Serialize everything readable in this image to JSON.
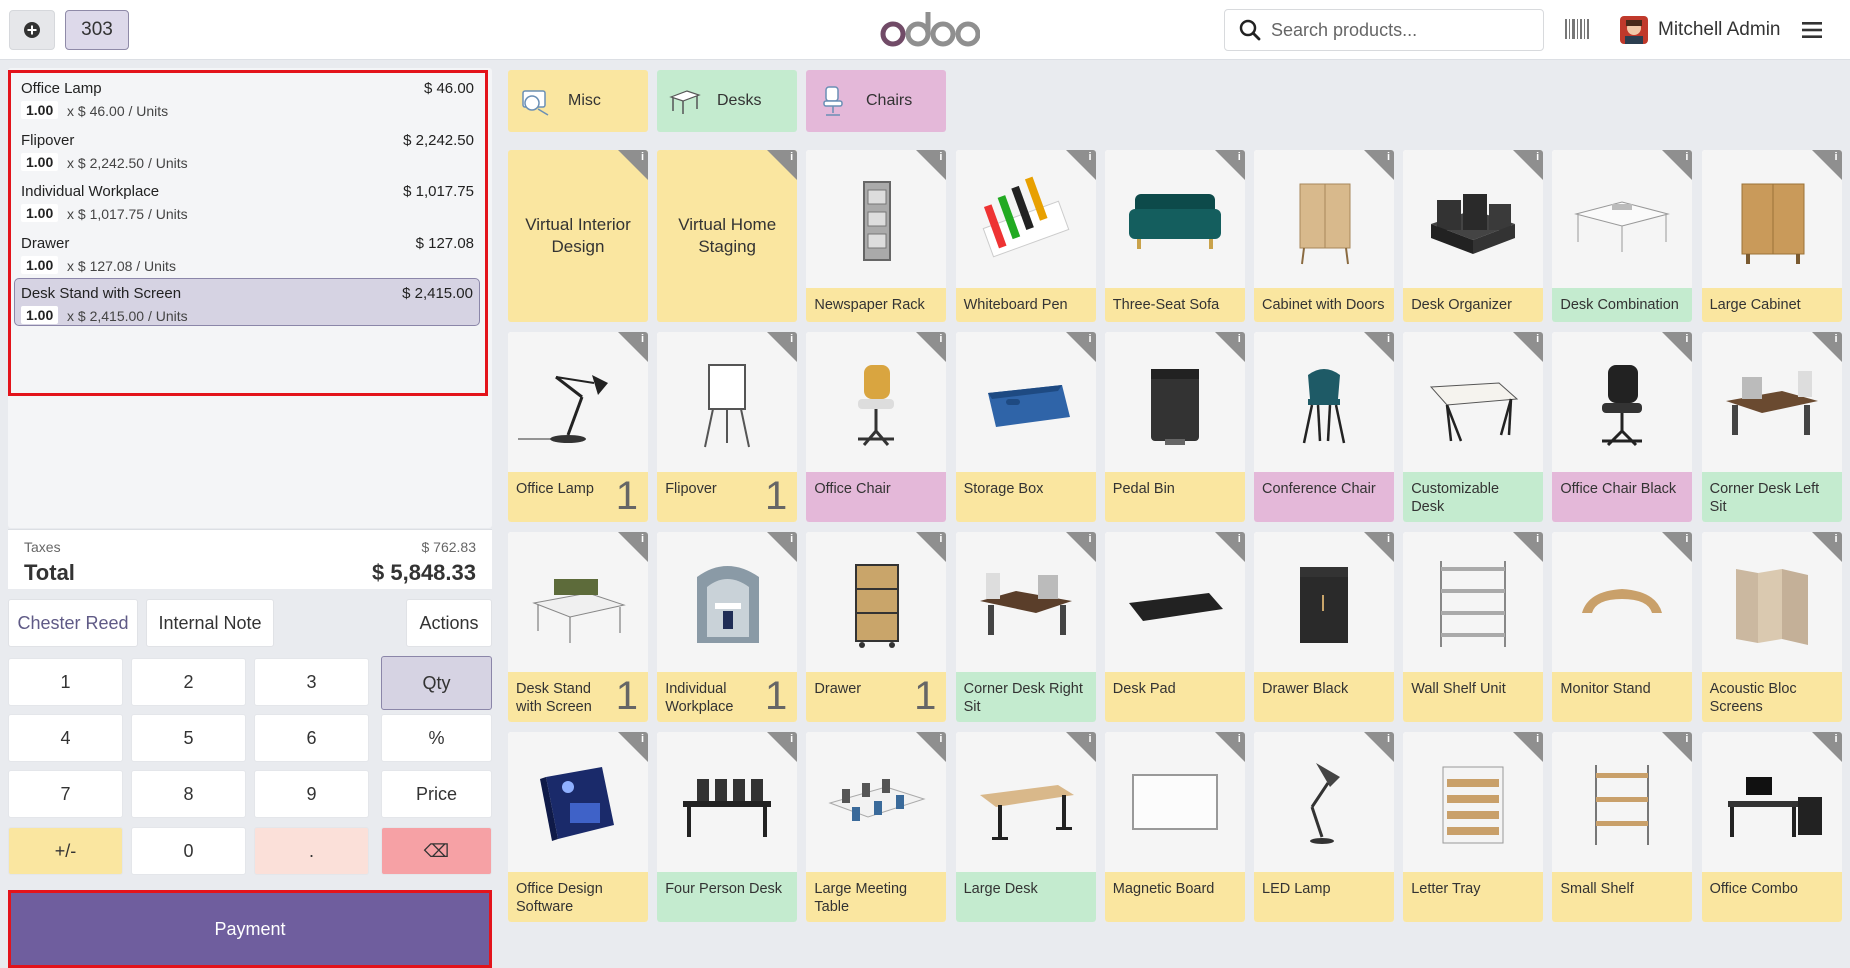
{
  "header": {
    "order_number": "303",
    "search_placeholder": "Search products...",
    "user_name": "Mitchell Admin"
  },
  "order_lines": [
    {
      "name": "Office Lamp",
      "price": "$ 46.00",
      "qty": "1.00",
      "unit": "x $ 46.00 / Units",
      "selected": false
    },
    {
      "name": "Flipover",
      "price": "$ 2,242.50",
      "qty": "1.00",
      "unit": "x $ 2,242.50 / Units",
      "selected": false
    },
    {
      "name": "Individual Workplace",
      "price": "$ 1,017.75",
      "qty": "1.00",
      "unit": "x $ 1,017.75 / Units",
      "selected": false
    },
    {
      "name": "Drawer",
      "price": "$ 127.08",
      "qty": "1.00",
      "unit": "x $ 127.08 / Units",
      "selected": false
    },
    {
      "name": "Desk Stand with Screen",
      "price": "$ 2,415.00",
      "qty": "1.00",
      "unit": "x $ 2,415.00 / Units",
      "selected": true
    }
  ],
  "totals": {
    "taxes_label": "Taxes",
    "taxes_value": "$ 762.83",
    "total_label": "Total",
    "total_value": "$ 5,848.33"
  },
  "controls": {
    "customer": "Chester Reed",
    "note": "Internal Note",
    "actions": "Actions"
  },
  "numpad": {
    "k1": "1",
    "k2": "2",
    "k3": "3",
    "qty": "Qty",
    "k4": "4",
    "k5": "5",
    "k6": "6",
    "percent": "%",
    "k7": "7",
    "k8": "8",
    "k9": "9",
    "price": "Price",
    "plusminus": "+/-",
    "k0": "0",
    "dot": ".",
    "backspace": "⌫"
  },
  "payment_label": "Payment",
  "categories": [
    {
      "label": "Misc",
      "color": "#fae6a0"
    },
    {
      "label": "Desks",
      "color": "#c4ebcf"
    },
    {
      "label": "Chairs",
      "color": "#e4b8d9"
    }
  ],
  "colors": {
    "yellow": "#fae6a0",
    "green": "#c4ebcf",
    "pink": "#e4b8d9",
    "payment": "#6f5e9e"
  },
  "products": [
    {
      "name": "Virtual Interior Design",
      "qty": ""
    },
    {
      "name": "Virtual Home Staging",
      "qty": ""
    },
    {
      "name": "Newspaper Rack",
      "qty": ""
    },
    {
      "name": "Whiteboard Pen",
      "qty": ""
    },
    {
      "name": "Three-Seat Sofa",
      "qty": ""
    },
    {
      "name": "Cabinet with Doors",
      "qty": ""
    },
    {
      "name": "Desk Organizer",
      "qty": ""
    },
    {
      "name": "Desk Combination",
      "qty": ""
    },
    {
      "name": "Large Cabinet",
      "qty": ""
    },
    {
      "name": "Office Lamp",
      "qty": "1"
    },
    {
      "name": "Flipover",
      "qty": "1"
    },
    {
      "name": "Office Chair",
      "qty": ""
    },
    {
      "name": "Storage Box",
      "qty": ""
    },
    {
      "name": "Pedal Bin",
      "qty": ""
    },
    {
      "name": "Conference Chair",
      "qty": ""
    },
    {
      "name": "Customizable Desk",
      "qty": ""
    },
    {
      "name": "Office Chair Black",
      "qty": ""
    },
    {
      "name": "Corner Desk Left Sit",
      "qty": ""
    },
    {
      "name": "Desk Stand with Screen",
      "qty": "1"
    },
    {
      "name": "Individual Workplace",
      "qty": "1"
    },
    {
      "name": "Drawer",
      "qty": "1"
    },
    {
      "name": "Corner Desk Right Sit",
      "qty": ""
    },
    {
      "name": "Desk Pad",
      "qty": ""
    },
    {
      "name": "Drawer Black",
      "qty": ""
    },
    {
      "name": "Wall Shelf Unit",
      "qty": ""
    },
    {
      "name": "Monitor Stand",
      "qty": ""
    },
    {
      "name": "Acoustic Bloc Screens",
      "qty": ""
    },
    {
      "name": "Office Design Software",
      "qty": ""
    },
    {
      "name": "Four Person Desk",
      "qty": ""
    },
    {
      "name": "Large Meeting Table",
      "qty": ""
    },
    {
      "name": "Large Desk",
      "qty": ""
    },
    {
      "name": "Magnetic Board",
      "qty": ""
    },
    {
      "name": "LED Lamp",
      "qty": ""
    },
    {
      "name": "Letter Tray",
      "qty": ""
    },
    {
      "name": "Small Shelf",
      "qty": ""
    },
    {
      "name": "Office Combo",
      "qty": ""
    }
  ]
}
